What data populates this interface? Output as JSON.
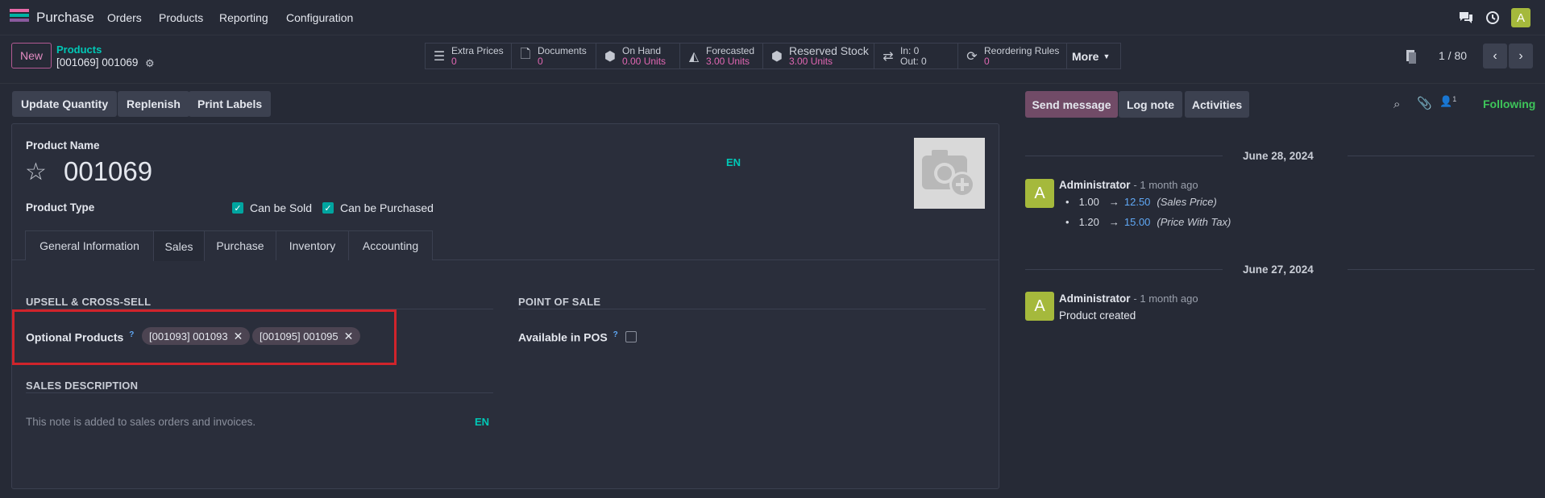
{
  "navbar": {
    "app_name": "Purchase",
    "menu": [
      "Orders",
      "Products",
      "Reporting",
      "Configuration"
    ],
    "user_initial": "A"
  },
  "control": {
    "new_label": "New",
    "breadcrumb_parent": "Products",
    "breadcrumb_current": "[001069] 001069",
    "smart_buttons": [
      {
        "label": "Extra Prices",
        "value": "0",
        "icon": "list-icon"
      },
      {
        "label": "Documents",
        "value": "0",
        "icon": "file-icon"
      },
      {
        "label": "On Hand",
        "value": "0.00 Units",
        "icon": "cubes-icon"
      },
      {
        "label": "Forecasted",
        "value": "3.00 Units",
        "icon": "area-chart-icon"
      },
      {
        "label": "Reserved Stock",
        "value": "3.00 Units",
        "icon": "cubes-icon"
      },
      {
        "label": "In: 0",
        "value": "Out: 0",
        "icon": "exchange-icon"
      },
      {
        "label": "Reordering Rules",
        "value": "0",
        "icon": "refresh-icon"
      }
    ],
    "more_label": "More",
    "pager": "1 / 80"
  },
  "actions": {
    "update_quantity": "Update Quantity",
    "replenish": "Replenish",
    "print_labels": "Print Labels"
  },
  "form": {
    "product_name_label": "Product Name",
    "product_name": "001069",
    "lang": "EN",
    "product_type_label": "Product Type",
    "can_be_sold": "Can be Sold",
    "can_be_purchased": "Can be Purchased",
    "tabs": [
      "General Information",
      "Sales",
      "Purchase",
      "Inventory",
      "Accounting"
    ],
    "active_tab": "Sales",
    "upsell_title": "UPSELL & CROSS-SELL",
    "optional_products_label": "Optional Products",
    "help_mark": "?",
    "optional_products": [
      "[001093] 001093",
      "[001095] 001095"
    ],
    "pos_title": "POINT OF SALE",
    "available_in_pos_label": "Available in POS",
    "sales_description_title": "SALES DESCRIPTION",
    "sales_description_placeholder": "This note is added to sales orders and invoices.",
    "sales_description_lang": "EN"
  },
  "chatter": {
    "send_message": "Send message",
    "log_note": "Log note",
    "activities": "Activities",
    "followers_count": "1",
    "following": "Following",
    "groups": [
      {
        "date": "June 28, 2024",
        "author": "Administrator",
        "ago": "- 1 month ago",
        "tracking": [
          {
            "old": "1.00",
            "new": "12.50",
            "field": "(Sales Price)"
          },
          {
            "old": "1.20",
            "new": "15.00",
            "field": "(Price With Tax)"
          }
        ]
      },
      {
        "date": "June 27, 2024",
        "author": "Administrator",
        "ago": "- 1 month ago",
        "body": "Product created"
      }
    ],
    "avatar_initial": "A"
  },
  "colors": {
    "background": "#262a36",
    "accent_teal": "#00c8b6",
    "accent_pink": "#e067b2",
    "send_message_bg": "#714b67",
    "avatar_bg": "#a5b93c",
    "following_green": "#3ec55a",
    "highlight_red": "#d0242b"
  }
}
